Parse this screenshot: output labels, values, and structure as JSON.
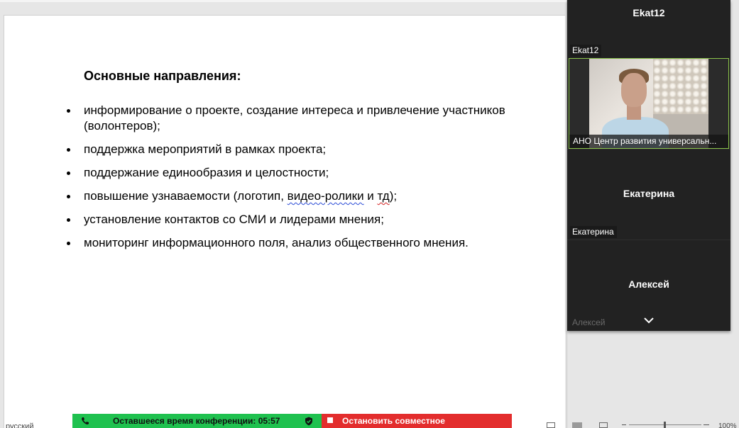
{
  "document": {
    "heading": "Основные направления:",
    "bullets": [
      {
        "text": "информирование о проекте, создание интереса и привлечение участников (волонтеров);"
      },
      {
        "text": "поддержка мероприятий в рамках проекта;"
      },
      {
        "text": "поддержание единообразия и целостности;"
      },
      {
        "pre": "повышение узнаваемости (логотип, ",
        "mark1": "видео-ролики",
        "mid": " и ",
        "mark2": "тд",
        "post": ");"
      },
      {
        "text": "установление контактов со СМИ и лидерами мнения;"
      },
      {
        "text": "мониторинг информационного поля, анализ общественного мнения."
      }
    ]
  },
  "video_panel": {
    "participants": [
      {
        "name_big": "Ekat12",
        "label": "Ekat12",
        "video_caption": "АНО Центр развития универсальн..."
      },
      {
        "name_big": "Екатерина",
        "label": "Екатерина"
      },
      {
        "name_big": "Алексей",
        "label": "Алексей"
      }
    ],
    "expand_icon": "chevron-down-icon",
    "video_border_color": "#8bc34a"
  },
  "conference_bar": {
    "timer_text": "Оставшееся время конференции: 05:57",
    "stop_share_text": "Остановить совместное использование",
    "timer_color": "#1fc14f",
    "stop_color": "#e32d2d"
  },
  "status_bar": {
    "language": "русский",
    "zoom": "100%"
  }
}
